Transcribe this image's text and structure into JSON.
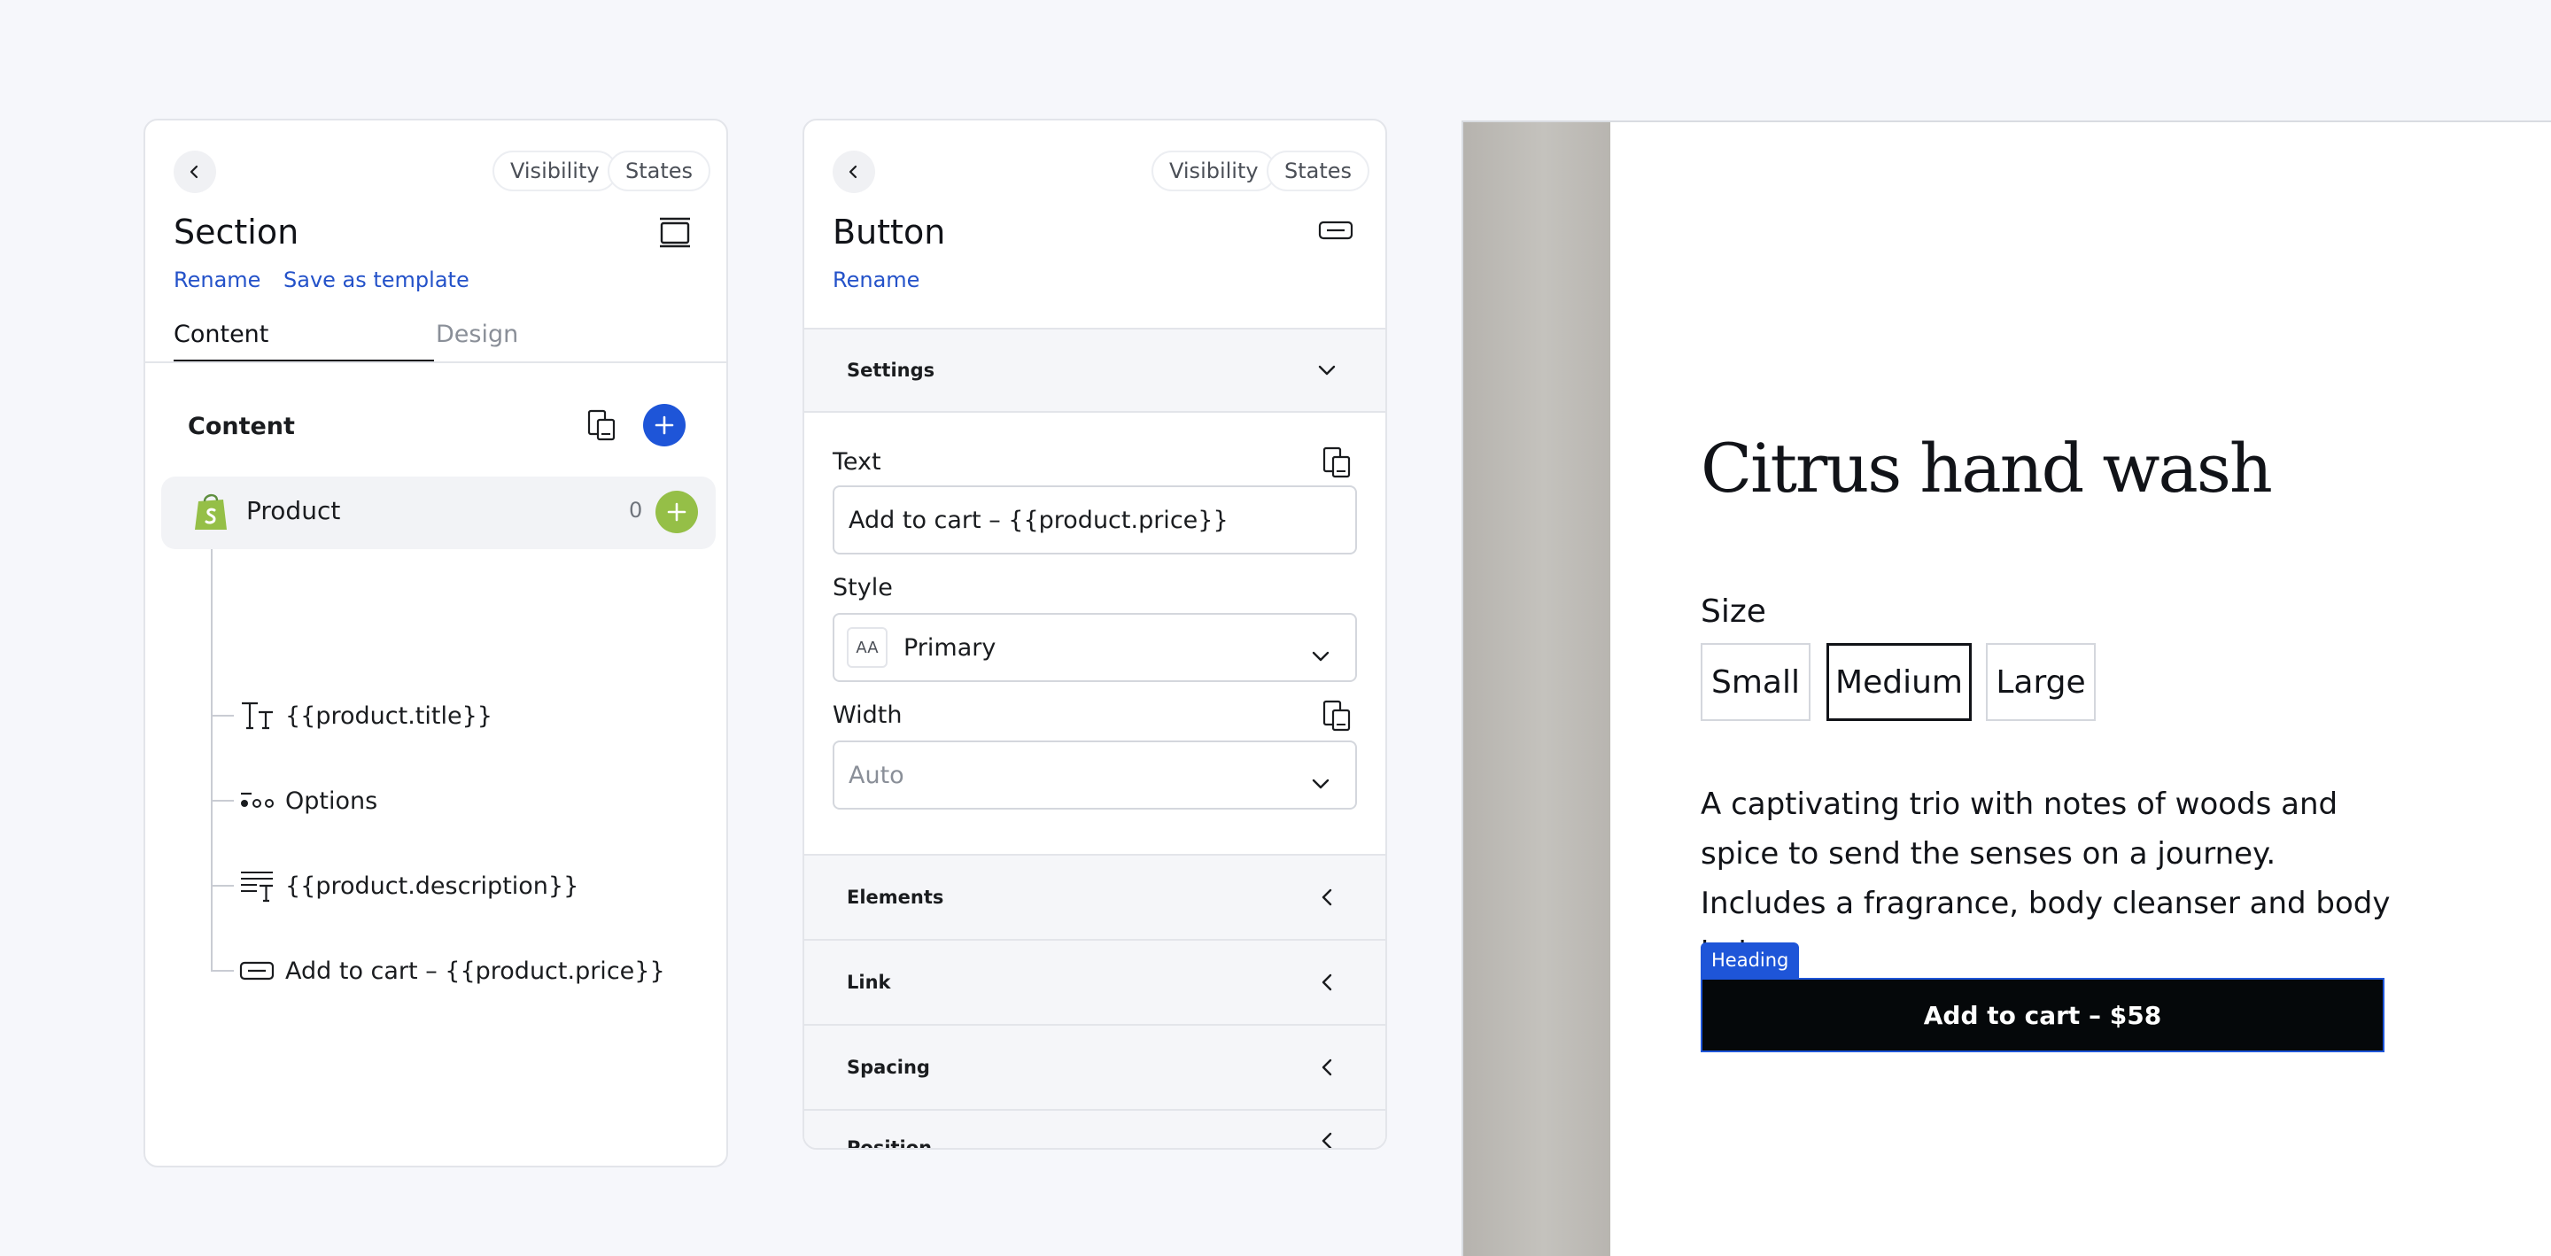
{
  "section_panel": {
    "visibility_label": "Visibility",
    "states_label": "States",
    "title": "Section",
    "rename_label": "Rename",
    "save_template_label": "Save as template",
    "tabs": [
      {
        "label": "Content"
      },
      {
        "label": "Design"
      }
    ],
    "content_header": "Content",
    "product_row": {
      "label": "Product",
      "count": "0"
    },
    "tree_items": [
      {
        "label": "{{product.title}}",
        "icon": "text-type-icon"
      },
      {
        "label": "Options",
        "icon": "options-icon"
      },
      {
        "label": "{{product.description}}",
        "icon": "paragraph-icon"
      },
      {
        "label": "Add to cart –  {{product.price}}",
        "icon": "button-icon"
      }
    ]
  },
  "button_panel": {
    "visibility_label": "Visibility",
    "states_label": "States",
    "title": "Button",
    "rename_label": "Rename",
    "settings_label": "Settings",
    "text_label": "Text",
    "text_value": "Add to cart –  {{product.price}}",
    "style_label": "Style",
    "style_badge": "AA",
    "style_value": "Primary",
    "width_label": "Width",
    "width_value": "Auto",
    "sections": [
      {
        "label": "Elements"
      },
      {
        "label": "Link"
      },
      {
        "label": "Spacing"
      },
      {
        "label": "Position"
      }
    ]
  },
  "preview": {
    "product_title": "Citrus hand wash",
    "size_label": "Size",
    "sizes": [
      {
        "label": "Small"
      },
      {
        "label": "Medium",
        "selected": true
      },
      {
        "label": "Large"
      }
    ],
    "description": "A captivating trio with notes of woods and spice to send the senses on a journey. Includes a fragrance, body cleanser and body balm.",
    "heading_badge": "Heading",
    "cart_button": "Add to cart – $58"
  },
  "colors": {
    "accent_blue": "#1e55d8",
    "link_blue": "#2452c9",
    "shopify_green": "#95bf47",
    "button_black": "#05080a"
  }
}
